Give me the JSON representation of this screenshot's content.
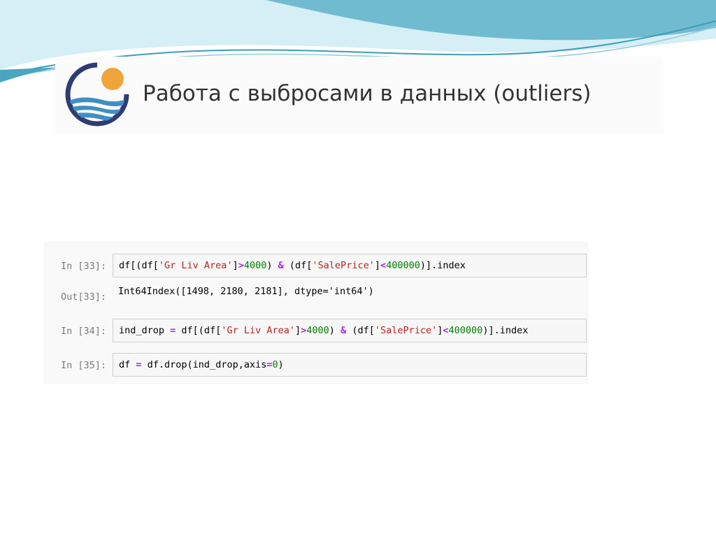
{
  "slide": {
    "title": "Работа с выбросами в данных (outliers)"
  },
  "colors": {
    "wave_light": "#bfe4ef",
    "wave_dark": "#5fb2c9",
    "logo_ring": "#2e3b74",
    "logo_sun": "#f0a53c",
    "logo_water": "#3f8fc4"
  },
  "notebook": {
    "cells": [
      {
        "in_prompt": "In [33]:",
        "code": [
          "df[(df[",
          "'Gr Liv Area'",
          "]",
          ">",
          "4000",
          ") ",
          "&",
          " (df[",
          "'SalePrice'",
          "]",
          "<",
          "400000",
          ")].index"
        ]
      },
      {
        "out_prompt": "Out[33]:",
        "output": "Int64Index([1498, 2180, 2181], dtype='int64')"
      },
      {
        "in_prompt": "In [34]:",
        "code": [
          "ind_drop ",
          "=",
          " df[(df[",
          "'Gr Liv Area'",
          "]",
          ">",
          "4000",
          ") ",
          "&",
          " (df[",
          "'SalePrice'",
          "]",
          "<",
          "400000",
          ")].index"
        ]
      },
      {
        "in_prompt": "In [35]:",
        "code": [
          "df ",
          "=",
          " df.drop(ind_drop,axis",
          "=",
          "0",
          ")"
        ]
      }
    ]
  }
}
